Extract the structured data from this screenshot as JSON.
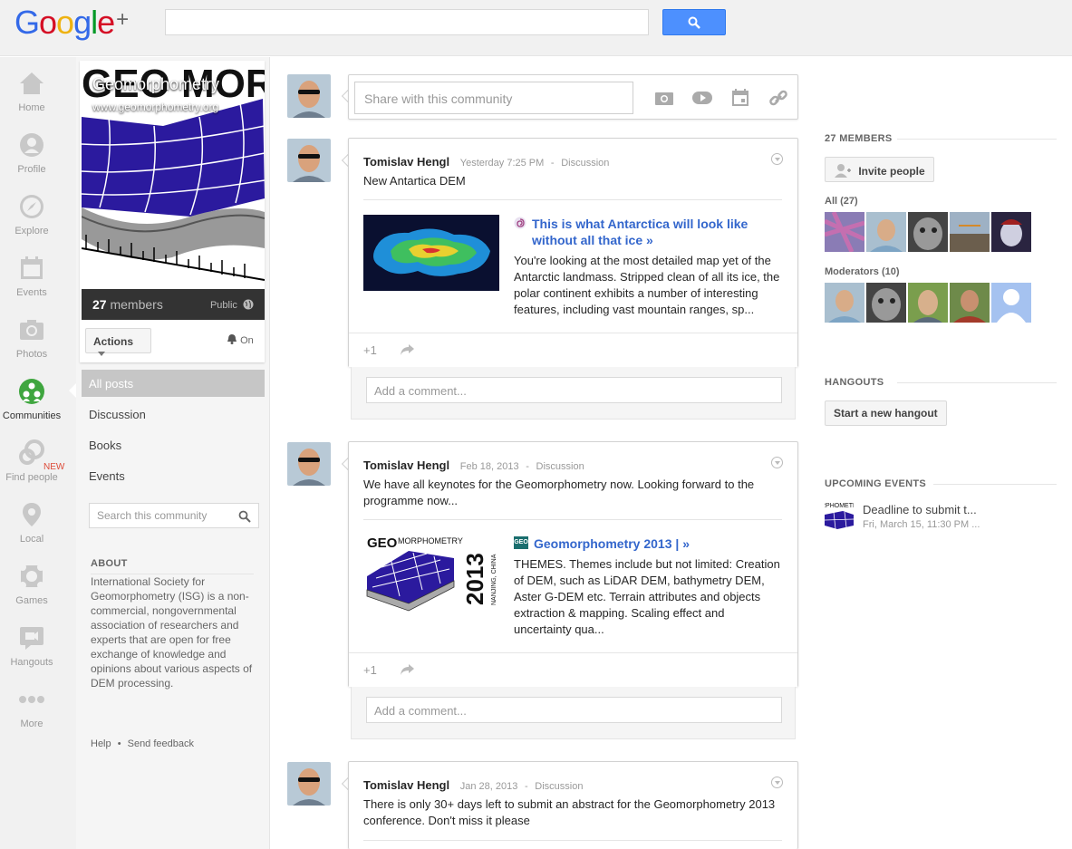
{
  "app": {
    "logo_text": "Google",
    "logo_plus": "+",
    "colors": {
      "accent": "#4d90fe",
      "link": "#3366cc",
      "new_badge": "#dd4b39",
      "active_nav": "#3fa63f"
    }
  },
  "leftnav": {
    "items": [
      {
        "label": "Home",
        "icon": "home-icon"
      },
      {
        "label": "Profile",
        "icon": "profile-icon"
      },
      {
        "label": "Explore",
        "icon": "compass-icon"
      },
      {
        "label": "Events",
        "icon": "calendar-icon"
      },
      {
        "label": "Photos",
        "icon": "camera-icon"
      },
      {
        "label": "Communities",
        "icon": "communities-icon",
        "active": true
      },
      {
        "label": "Find people",
        "icon": "find-people-icon",
        "badge": "NEW"
      },
      {
        "label": "Local",
        "icon": "map-pin-icon"
      },
      {
        "label": "Games",
        "icon": "games-icon"
      },
      {
        "label": "Hangouts",
        "icon": "hangouts-icon"
      },
      {
        "label": "More",
        "icon": "more-icon"
      }
    ]
  },
  "community": {
    "cover_logo_text": "GEO MORPHO",
    "cover_title": "Geomorphometry",
    "cover_url": "www.geomorphometry.org",
    "members_count": "27",
    "members_label": "members",
    "visibility": "Public",
    "actions_label": "Actions",
    "notifications_label": "On",
    "filters": [
      "All posts",
      "Discussion",
      "Books",
      "Events"
    ],
    "search_placeholder": "Search this community",
    "about_heading": "ABOUT",
    "about_text": "International Society for Geomorphometry (ISG) is a non-commercial, nongovernmental association of researchers and experts that are open for free exchange of knowledge and opinions about various aspects of DEM processing.",
    "footer_help": "Help",
    "footer_sep": "•",
    "footer_feedback": "Send feedback"
  },
  "share": {
    "placeholder": "Share with this community"
  },
  "posts": [
    {
      "author": "Tomislav Hengl",
      "time": "Yesterday 7:25 PM",
      "sep": "-",
      "category": "Discussion",
      "text": "New Antartica DEM",
      "attachment": {
        "title": "This is what Antarctica will look like without all that ice »",
        "desc": "You're looking at the most detailed map yet of the Antarctic landmass. Stripped clean of all its ice, the polar continent exhibits a number of interesting features, including vast mountain ranges, sp..."
      },
      "plus_one": "+1",
      "comment_placeholder": "Add a comment..."
    },
    {
      "author": "Tomislav Hengl",
      "time": "Feb 18, 2013",
      "sep": "-",
      "category": "Discussion",
      "text": "We have all keynotes for the Geomorphometry now. Looking forward to the programme now...",
      "attachment": {
        "image_text_geo": "GEO",
        "image_text_morpho": "MORPHOMETRY",
        "image_text_year": "2013",
        "image_text_place": "NANJING, CHINA",
        "favicon_text": "GEO",
        "title": "Geomorphometry 2013 | »",
        "desc": "THEMES. Themes include but not limited: Creation of DEM, such as LiDAR DEM, bathymetry DEM, Aster G-DEM etc. Terrain attributes and objects extraction & mapping. Scaling effect and uncertainty qua..."
      },
      "plus_one": "+1",
      "comment_placeholder": "Add a comment..."
    },
    {
      "author": "Tomislav Hengl",
      "time": "Jan 28, 2013",
      "sep": "-",
      "category": "Discussion",
      "text": "There is only 30+ days left to submit an abstract for the Geomorphometry 2013 conference. Don't miss it please"
    }
  ],
  "right": {
    "members_heading": "27 MEMBERS",
    "invite_label": "Invite people",
    "all_label": "All (27)",
    "moderators_label": "Moderators (10)",
    "hangouts_heading": "HANGOUTS",
    "hangout_btn": "Start a new hangout",
    "events_heading": "UPCOMING EVENTS",
    "event_title": "Deadline to submit t...",
    "event_date": "Fri, March 15, 11:30 PM ...",
    "event_thumb_text": "RPHOMETRY"
  }
}
